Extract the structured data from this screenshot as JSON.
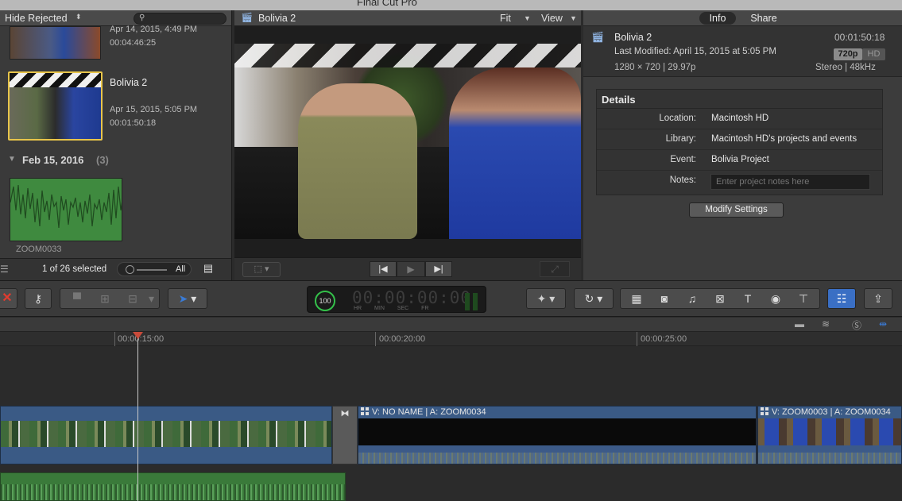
{
  "window": {
    "title": "Final Cut Pro"
  },
  "browser": {
    "filter_label": "Hide Rejected",
    "clips": [
      {
        "date": "Apr 14, 2015, 4:49 PM",
        "duration": "00:04:46:25"
      },
      {
        "name": "Bolivia 2",
        "date": "Apr 15, 2015, 5:05 PM",
        "duration": "00:01:50:18",
        "selected": true
      }
    ],
    "group": {
      "date": "Feb 15, 2016",
      "count": "(3)"
    },
    "audio_clip": {
      "name": "ZOOM0033"
    },
    "selection_status": "1 of 26 selected",
    "zoom_label": "All"
  },
  "viewer": {
    "title": "Bolivia 2",
    "fit_label": "Fit",
    "view_label": "View"
  },
  "inspector": {
    "tabs": [
      "Info",
      "Share"
    ],
    "clip_name": "Bolivia 2",
    "duration": "00:01:50:18",
    "last_modified": "Last Modified: April 15, 2015 at 5:05 PM",
    "badges": {
      "res": "720p",
      "hd": "HD"
    },
    "format": "1280 × 720  |  29.97p",
    "audio": "Stereo  |  48kHz",
    "details": {
      "title": "Details",
      "rows": [
        {
          "label": "Location:",
          "value": "Macintosh HD"
        },
        {
          "label": "Library:",
          "value": "Macintosh HD's projects and events"
        },
        {
          "label": "Event:",
          "value": "Bolivia Project"
        },
        {
          "label": "Notes:",
          "placeholder": "Enter project notes here"
        }
      ]
    },
    "modify_button": "Modify Settings"
  },
  "toolbar": {
    "timecode": {
      "percent": "100",
      "digits": "00:00:00:00",
      "units": "HR MIN SEC FR"
    }
  },
  "timeline": {
    "ruler": [
      "00:00:15:00",
      "00:00:20:00",
      "00:00:25:00"
    ],
    "clips": [
      {
        "label": "V: NO NAME | A: ZOOM0034"
      },
      {
        "label": "V: ZOOM0003 | A: ZOOM0034"
      }
    ]
  },
  "icons": {
    "search": "search-icon",
    "clip": "clapper-icon",
    "reject": "reject-icon",
    "keyword": "key-icon",
    "select_tool": "arrow-icon",
    "enhance": "magic-wand-icon",
    "retime": "retime-icon",
    "effects_browser": "effects-browser-icon",
    "share": "share-icon"
  },
  "colors": {
    "selection": "#e8c54a",
    "accent": "#3a6fc4",
    "reject": "#e13b2f",
    "timecode_ring": "#34c04a",
    "playhead": "#c84a3a"
  }
}
